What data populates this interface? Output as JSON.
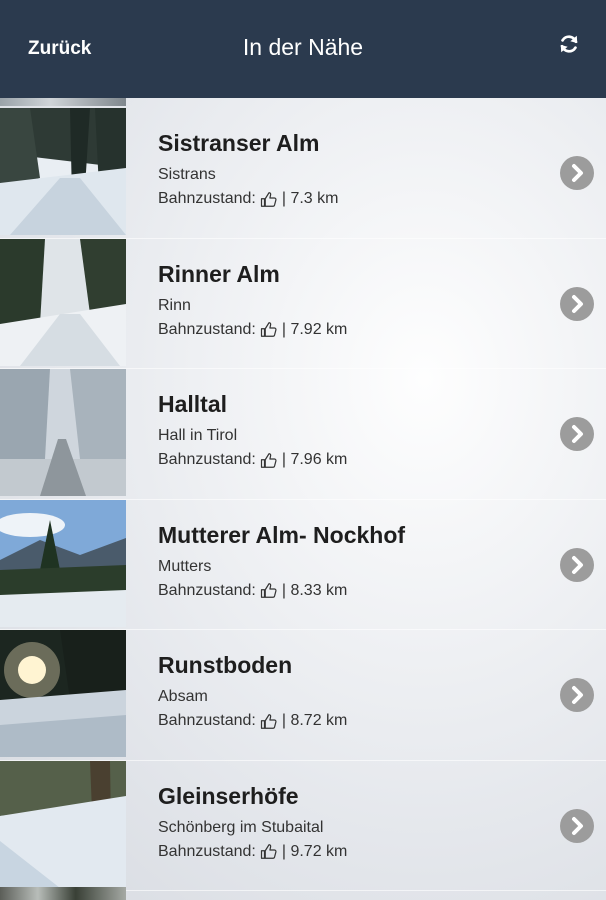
{
  "header": {
    "back_label": "Zurück",
    "title": "In der Nähe",
    "refresh_icon": "refresh-icon"
  },
  "items": [
    {
      "name": "Sistranser Alm",
      "place": "Sistrans",
      "status_label": "Bahnzustand:",
      "distance": "| 7.3 km",
      "scene": "forest-road"
    },
    {
      "name": "Rinner Alm",
      "place": "Rinn",
      "status_label": "Bahnzustand:",
      "distance": "| 7.92 km",
      "scene": "open-trail"
    },
    {
      "name": "Halltal",
      "place": "Hall in Tirol",
      "status_label": "Bahnzustand:",
      "distance": "| 7.96 km",
      "scene": "snowy-trees"
    },
    {
      "name": "Mutterer Alm- Nockhof",
      "place": "Mutters",
      "status_label": "Bahnzustand:",
      "distance": "| 8.33 km",
      "scene": "mountain-view"
    },
    {
      "name": "Runstboden",
      "place": "Absam",
      "status_label": "Bahnzustand:",
      "distance": "| 8.72 km",
      "scene": "sunburst"
    },
    {
      "name": "Gleinserhöfe",
      "place": "Schönberg im Stubaital",
      "status_label": "Bahnzustand:",
      "distance": "| 9.72 km",
      "scene": "slope"
    }
  ],
  "colors": {
    "header_bg": "#2b3a4e",
    "chevron_bg": "#9c9c9c"
  }
}
